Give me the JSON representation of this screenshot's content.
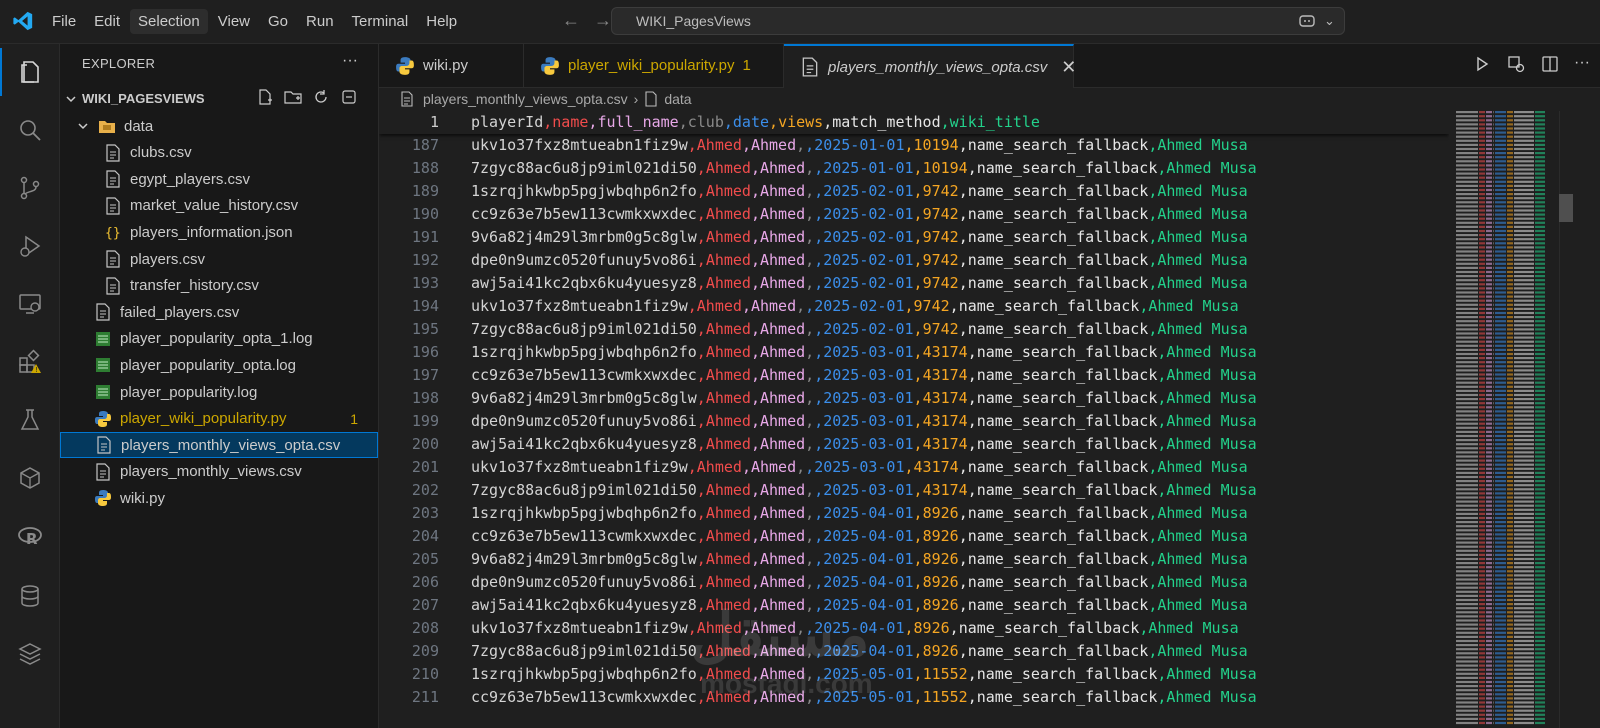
{
  "titlebar": {
    "menu": [
      "File",
      "Edit",
      "Selection",
      "View",
      "Go",
      "Run",
      "Terminal",
      "Help"
    ],
    "active_menu_index": 2,
    "command_center": "WIKI_PagesViews"
  },
  "activity_bar": {
    "items": [
      "explorer-icon",
      "search-icon",
      "source-control-icon",
      "run-debug-icon",
      "remote-explorer-icon",
      "extensions-icon",
      "testing-icon",
      "containers-icon",
      "r-icon",
      "database-icon",
      "layers-icon"
    ]
  },
  "sidebar": {
    "title": "EXPLORER",
    "folder_name": "WIKI_PAGESVIEWS",
    "tree": [
      {
        "label": "data",
        "type": "folder",
        "indent": 1,
        "expanded": true
      },
      {
        "label": "clubs.csv",
        "type": "csv",
        "indent": 2
      },
      {
        "label": "egypt_players.csv",
        "type": "csv",
        "indent": 2
      },
      {
        "label": "market_value_history.csv",
        "type": "csv",
        "indent": 2
      },
      {
        "label": "players_information.json",
        "type": "json",
        "indent": 2
      },
      {
        "label": "players.csv",
        "type": "csv",
        "indent": 2
      },
      {
        "label": "transfer_history.csv",
        "type": "csv",
        "indent": 2
      },
      {
        "label": "failed_players.csv",
        "type": "csv",
        "indent": 1
      },
      {
        "label": "player_popularity_opta_1.log",
        "type": "log",
        "indent": 1
      },
      {
        "label": "player_popularity_opta.log",
        "type": "log",
        "indent": 1
      },
      {
        "label": "player_popularity.log",
        "type": "log",
        "indent": 1
      },
      {
        "label": "player_wiki_popularity.py",
        "type": "py",
        "indent": 1,
        "badge": "1",
        "warning": true
      },
      {
        "label": "players_monthly_views_opta.csv",
        "type": "csv",
        "indent": 1,
        "selected": true
      },
      {
        "label": "players_monthly_views.csv",
        "type": "csv",
        "indent": 1
      },
      {
        "label": "wiki.py",
        "type": "py",
        "indent": 1
      }
    ]
  },
  "tabs": [
    {
      "label": "wiki.py",
      "type": "py"
    },
    {
      "label": "player_wiki_popularity.py",
      "type": "py",
      "badge": "1",
      "warning": true
    },
    {
      "label": "players_monthly_views_opta.csv",
      "type": "csv",
      "active": true
    }
  ],
  "breadcrumb": {
    "file": "players_monthly_views_opta.csv",
    "symbol": "data"
  },
  "colors": {
    "accent": "#0078d4",
    "col_id": "#d4d4d4",
    "col_name": "#f14c4c",
    "col_full_name": "#e8a8e8",
    "col_club": "#8a8a8a",
    "col_date": "#3b8eea",
    "col_views": "#f5a623",
    "col_method": "#e6e6e6",
    "col_title": "#23d18b",
    "warning": "#cca700"
  },
  "editor": {
    "header_line": {
      "num": "1",
      "fields": [
        "playerId",
        "name",
        "full_name",
        "club",
        "date",
        "views",
        "match_method",
        "wiki_title"
      ]
    },
    "lines": [
      {
        "num": "187",
        "fields": [
          "ukv1o37fxz8mtueabn1fiz9w",
          "Ahmed",
          "Ahmed",
          "",
          "2025-01-01",
          "10194",
          "name_search_fallback",
          "Ahmed Musa"
        ]
      },
      {
        "num": "188",
        "fields": [
          "7zgyc88ac6u8jp9iml021di50",
          "Ahmed",
          "Ahmed",
          "",
          "2025-01-01",
          "10194",
          "name_search_fallback",
          "Ahmed Musa"
        ]
      },
      {
        "num": "189",
        "fields": [
          "1szrqjhkwbp5pgjwbqhp6n2fo",
          "Ahmed",
          "Ahmed",
          "",
          "2025-02-01",
          "9742",
          "name_search_fallback",
          "Ahmed Musa"
        ]
      },
      {
        "num": "190",
        "fields": [
          "cc9z63e7b5ew113cwmkxwxdec",
          "Ahmed",
          "Ahmed",
          "",
          "2025-02-01",
          "9742",
          "name_search_fallback",
          "Ahmed Musa"
        ]
      },
      {
        "num": "191",
        "fields": [
          "9v6a82j4m29l3mrbm0g5c8glw",
          "Ahmed",
          "Ahmed",
          "",
          "2025-02-01",
          "9742",
          "name_search_fallback",
          "Ahmed Musa"
        ]
      },
      {
        "num": "192",
        "fields": [
          "dpe0n9umzc0520funuy5vo86i",
          "Ahmed",
          "Ahmed",
          "",
          "2025-02-01",
          "9742",
          "name_search_fallback",
          "Ahmed Musa"
        ]
      },
      {
        "num": "193",
        "fields": [
          "awj5ai41kc2qbx6ku4yuesyz8",
          "Ahmed",
          "Ahmed",
          "",
          "2025-02-01",
          "9742",
          "name_search_fallback",
          "Ahmed Musa"
        ]
      },
      {
        "num": "194",
        "fields": [
          "ukv1o37fxz8mtueabn1fiz9w",
          "Ahmed",
          "Ahmed",
          "",
          "2025-02-01",
          "9742",
          "name_search_fallback",
          "Ahmed Musa"
        ]
      },
      {
        "num": "195",
        "fields": [
          "7zgyc88ac6u8jp9iml021di50",
          "Ahmed",
          "Ahmed",
          "",
          "2025-02-01",
          "9742",
          "name_search_fallback",
          "Ahmed Musa"
        ]
      },
      {
        "num": "196",
        "fields": [
          "1szrqjhkwbp5pgjwbqhp6n2fo",
          "Ahmed",
          "Ahmed",
          "",
          "2025-03-01",
          "43174",
          "name_search_fallback",
          "Ahmed Musa"
        ]
      },
      {
        "num": "197",
        "fields": [
          "cc9z63e7b5ew113cwmkxwxdec",
          "Ahmed",
          "Ahmed",
          "",
          "2025-03-01",
          "43174",
          "name_search_fallback",
          "Ahmed Musa"
        ]
      },
      {
        "num": "198",
        "fields": [
          "9v6a82j4m29l3mrbm0g5c8glw",
          "Ahmed",
          "Ahmed",
          "",
          "2025-03-01",
          "43174",
          "name_search_fallback",
          "Ahmed Musa"
        ]
      },
      {
        "num": "199",
        "fields": [
          "dpe0n9umzc0520funuy5vo86i",
          "Ahmed",
          "Ahmed",
          "",
          "2025-03-01",
          "43174",
          "name_search_fallback",
          "Ahmed Musa"
        ]
      },
      {
        "num": "200",
        "fields": [
          "awj5ai41kc2qbx6ku4yuesyz8",
          "Ahmed",
          "Ahmed",
          "",
          "2025-03-01",
          "43174",
          "name_search_fallback",
          "Ahmed Musa"
        ]
      },
      {
        "num": "201",
        "fields": [
          "ukv1o37fxz8mtueabn1fiz9w",
          "Ahmed",
          "Ahmed",
          "",
          "2025-03-01",
          "43174",
          "name_search_fallback",
          "Ahmed Musa"
        ]
      },
      {
        "num": "202",
        "fields": [
          "7zgyc88ac6u8jp9iml021di50",
          "Ahmed",
          "Ahmed",
          "",
          "2025-03-01",
          "43174",
          "name_search_fallback",
          "Ahmed Musa"
        ]
      },
      {
        "num": "203",
        "fields": [
          "1szrqjhkwbp5pgjwbqhp6n2fo",
          "Ahmed",
          "Ahmed",
          "",
          "2025-04-01",
          "8926",
          "name_search_fallback",
          "Ahmed Musa"
        ]
      },
      {
        "num": "204",
        "fields": [
          "cc9z63e7b5ew113cwmkxwxdec",
          "Ahmed",
          "Ahmed",
          "",
          "2025-04-01",
          "8926",
          "name_search_fallback",
          "Ahmed Musa"
        ]
      },
      {
        "num": "205",
        "fields": [
          "9v6a82j4m29l3mrbm0g5c8glw",
          "Ahmed",
          "Ahmed",
          "",
          "2025-04-01",
          "8926",
          "name_search_fallback",
          "Ahmed Musa"
        ]
      },
      {
        "num": "206",
        "fields": [
          "dpe0n9umzc0520funuy5vo86i",
          "Ahmed",
          "Ahmed",
          "",
          "2025-04-01",
          "8926",
          "name_search_fallback",
          "Ahmed Musa"
        ]
      },
      {
        "num": "207",
        "fields": [
          "awj5ai41kc2qbx6ku4yuesyz8",
          "Ahmed",
          "Ahmed",
          "",
          "2025-04-01",
          "8926",
          "name_search_fallback",
          "Ahmed Musa"
        ]
      },
      {
        "num": "208",
        "fields": [
          "ukv1o37fxz8mtueabn1fiz9w",
          "Ahmed",
          "Ahmed",
          "",
          "2025-04-01",
          "8926",
          "name_search_fallback",
          "Ahmed Musa"
        ]
      },
      {
        "num": "209",
        "fields": [
          "7zgyc88ac6u8jp9iml021di50",
          "Ahmed",
          "Ahmed",
          "",
          "2025-04-01",
          "8926",
          "name_search_fallback",
          "Ahmed Musa"
        ]
      },
      {
        "num": "210",
        "fields": [
          "1szrqjhkwbp5pgjwbqhp6n2fo",
          "Ahmed",
          "Ahmed",
          "",
          "2025-05-01",
          "11552",
          "name_search_fallback",
          "Ahmed Musa"
        ]
      },
      {
        "num": "211",
        "fields": [
          "cc9z63e7b5ew113cwmkxwxdec",
          "Ahmed",
          "Ahmed",
          "",
          "2025-05-01",
          "11552",
          "name_search_fallback",
          "Ahmed Musa"
        ]
      }
    ]
  },
  "watermark": {
    "main": "مستقل",
    "sub": "mostaql.com"
  }
}
